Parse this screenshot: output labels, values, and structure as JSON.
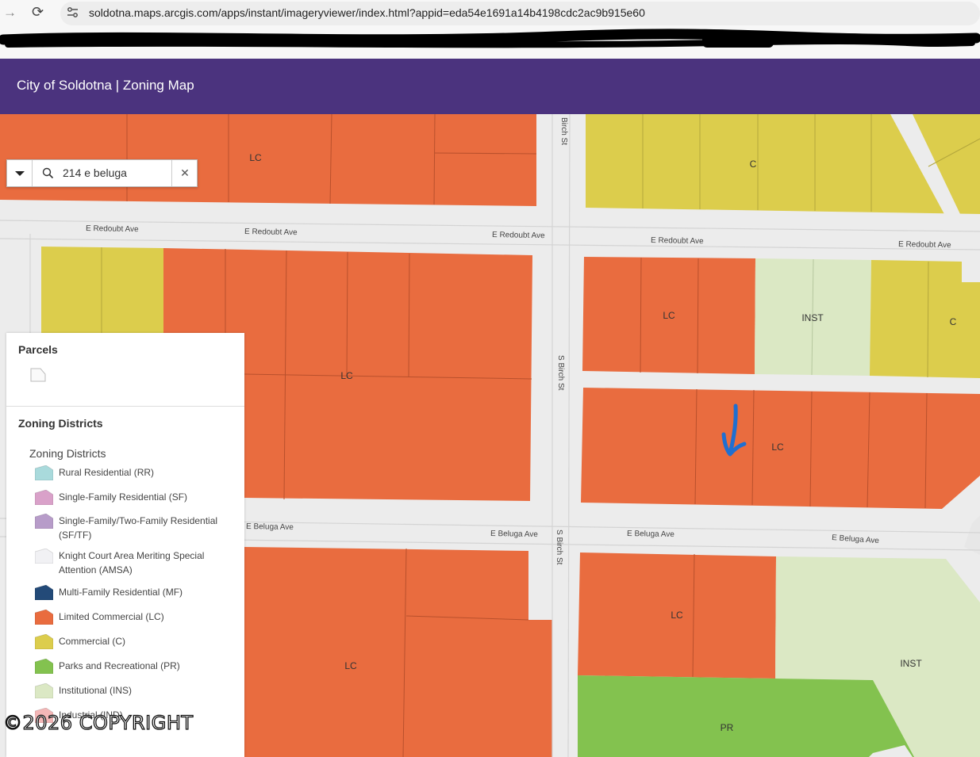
{
  "browser": {
    "url": "soldotna.maps.arcgis.com/apps/instant/imageryviewer/index.html?appid=eda54e1691a14b4198cdc2ac9b915e60"
  },
  "app": {
    "title": "City of Soldotna | Zoning Map"
  },
  "search": {
    "value": "214 e beluga",
    "clear_label": "✕"
  },
  "map": {
    "streets": {
      "redoubt": "E Redoubt Ave",
      "beluga": "E Beluga Ave",
      "birch_top": "Birch St",
      "birch": "S Birch St"
    },
    "zones": {
      "lc": "LC",
      "c": "C",
      "inst": "INST",
      "pr": "PR"
    }
  },
  "legend": {
    "parcels_title": "Parcels",
    "zoning_title": "Zoning Districts",
    "zoning_subtitle": "Zoning Districts",
    "items": [
      {
        "label": "Rural Residential (RR)",
        "color": "#a9dadc"
      },
      {
        "label": "Single-Family Residential (SF)",
        "color": "#d9a1c9"
      },
      {
        "label": "Single-Family/Two-Family Residential (SF/TF)",
        "color": "#b79cc9"
      },
      {
        "label": "Knight Court Area Meriting Special Attention (AMSA)",
        "color": "#f1f1f4"
      },
      {
        "label": "Multi-Family Residential (MF)",
        "color": "#234a78"
      },
      {
        "label": "Limited Commercial (LC)",
        "color": "#e96c3f"
      },
      {
        "label": "Commercial (C)",
        "color": "#dccd4c"
      },
      {
        "label": "Parks and Recreational (PR)",
        "color": "#83c24f"
      },
      {
        "label": "Institutional (INS)",
        "color": "#dbe8c4"
      },
      {
        "label": "Industrial (IND)",
        "color": "#f3b7b7"
      }
    ]
  },
  "watermark": "©2026 COPYRIGHT",
  "colors": {
    "header": "#4b337e",
    "lc": "#e96c3f",
    "c": "#dccd4c",
    "inst": "#dbe8c4",
    "pr": "#83c24f",
    "annotation": "#1f6fd1"
  }
}
